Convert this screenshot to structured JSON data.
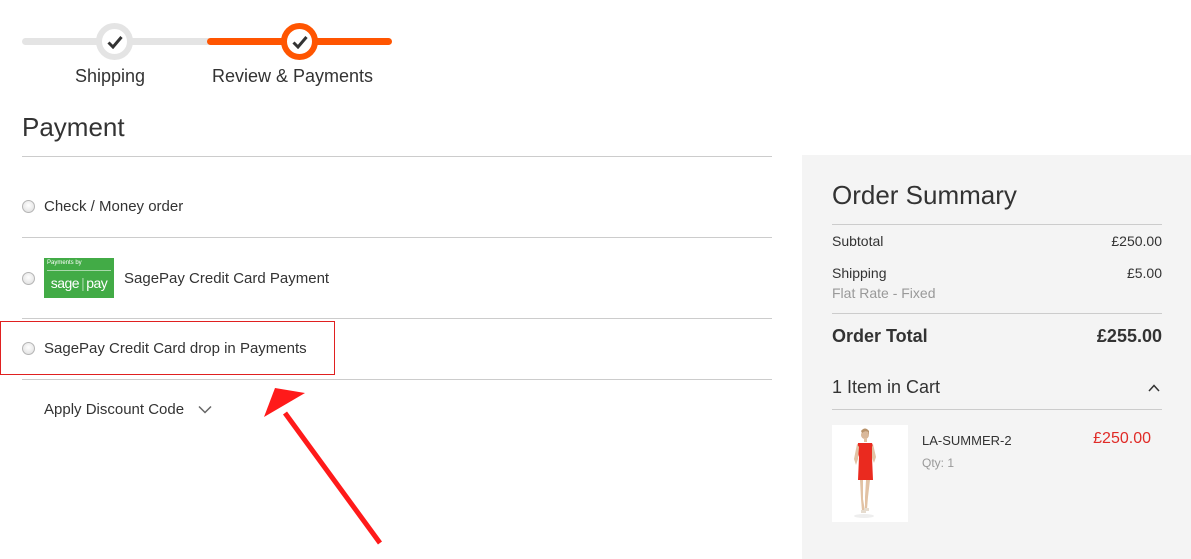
{
  "progress": {
    "steps": [
      {
        "label": "Shipping",
        "state": "complete"
      },
      {
        "label": "Review & Payments",
        "state": "active"
      }
    ],
    "colors": {
      "active": "#ff5501",
      "inactive": "#e4e4e4"
    }
  },
  "payment": {
    "title": "Payment",
    "methods": [
      {
        "label": "Check / Money order",
        "selected": false,
        "logo": null
      },
      {
        "label": "SagePay Credit Card Payment",
        "selected": false,
        "logo": {
          "caption": "Payments by",
          "brand_left": "sage",
          "brand_right": "pay"
        }
      },
      {
        "label": "SagePay Credit Card drop in Payments",
        "selected": false,
        "logo": null,
        "highlighted": true
      }
    ],
    "discount": {
      "label": "Apply Discount Code",
      "icon": "chevron-down-icon"
    }
  },
  "annotation": {
    "highlight_color": "#e02020",
    "arrow_color": "#ff1a1a"
  },
  "summary": {
    "title": "Order Summary",
    "rows": [
      {
        "label": "Subtotal",
        "value": "£250.00"
      },
      {
        "label": "Shipping",
        "value": "£5.00",
        "sub": "Flat Rate - Fixed"
      }
    ],
    "total": {
      "label": "Order Total",
      "value": "£255.00"
    },
    "cart": {
      "heading": "1 Item in Cart",
      "icon": "chevron-up-icon",
      "items": [
        {
          "name": "LA-SUMMER-2",
          "qty": "Qty: 1",
          "price": "£250.00",
          "image": "red-dress-product-image"
        }
      ]
    },
    "price_color": "#e02b27"
  }
}
